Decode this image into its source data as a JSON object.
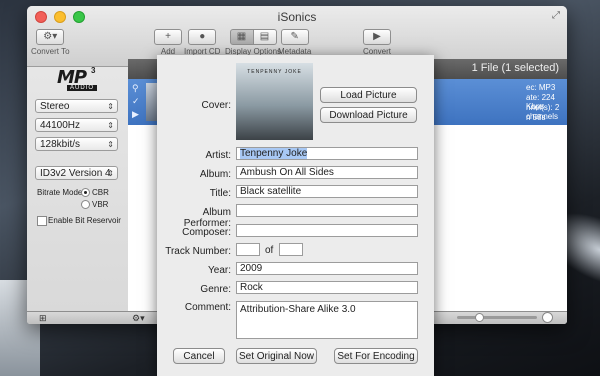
{
  "window": {
    "title": "iSonics"
  },
  "toolbar": {
    "convert_to": "Convert To",
    "add": "Add",
    "import_cd": "Import CD",
    "display_options": "Display Options",
    "metadata": "Metadata",
    "convert": "Convert"
  },
  "sidebar": {
    "channels": "Stereo",
    "sample_rate": "44100Hz",
    "bitrate": "128kbit/s",
    "id3_version": "ID3v2 Version 4",
    "bitrate_mode_label": "Bitrate Mode:",
    "cbr": "CBR",
    "vbr": "VBR",
    "bit_reservoir": "Enable Bit Reservoir",
    "logo": {
      "text": "MP",
      "sup": "3",
      "sub": "AUDIO"
    }
  },
  "list": {
    "file_count": "1 File (1 selected)",
    "row": {
      "codec": "ec: MP3",
      "rate": "ate: 224 Kbps",
      "channels": "nnel(s): 2 channels",
      "duration": "n 58s"
    }
  },
  "sheet": {
    "labels": {
      "cover": "Cover:",
      "artist": "Artist:",
      "album": "Album:",
      "title": "Title:",
      "album_performer": "Album Performer:",
      "composer": "Composer:",
      "track_number": "Track Number:",
      "of": "of",
      "year": "Year:",
      "genre": "Genre:",
      "comment": "Comment:"
    },
    "values": {
      "artist": "Tenpenny Joke",
      "album": "Ambush On All Sides",
      "title": "Black satellite",
      "album_performer": "",
      "composer": "",
      "track_number": "",
      "track_total": "",
      "year": "2009",
      "genre": "Rock",
      "comment": "Attribution-Share Alike 3.0"
    },
    "buttons": {
      "load_picture": "Load Picture",
      "download_picture": "Download Picture",
      "cancel": "Cancel",
      "set_original": "Set Original Now",
      "set_encoding": "Set For Encoding"
    },
    "cover_art_text": "TENPENNY JOKE"
  }
}
